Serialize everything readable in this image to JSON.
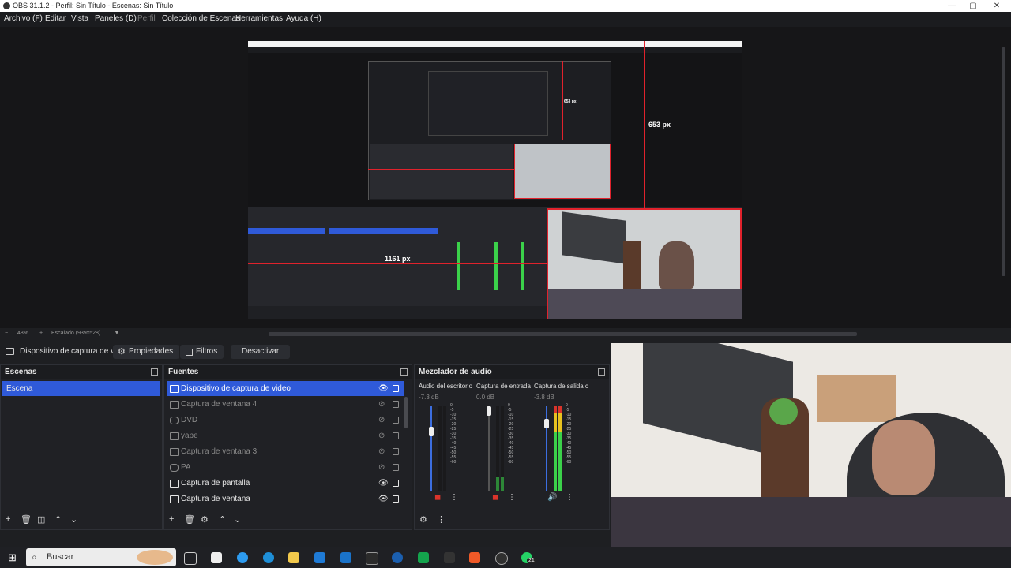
{
  "window": {
    "title": "OBS 31.1.2 - Perfil: Sin Título - Escenas: Sin Título",
    "minimize": "—",
    "maximize": "▢",
    "close": "✕"
  },
  "menu": {
    "items": [
      "Archivo (F)",
      "Editar",
      "Vista",
      "Paneles (D)",
      "Perfil",
      "Colección de Escenas",
      "Herramientas",
      "Ayuda (H)"
    ]
  },
  "preview": {
    "width_label": "1161 px",
    "height_label": "653 px",
    "inner_height_label": "653 px"
  },
  "zoom": {
    "minus": "−",
    "value": "48%",
    "plus": "+",
    "mode": "Escalado (939x528)"
  },
  "source_toolbar": {
    "source": "Dispositivo de captura de v",
    "properties": "Propiedades",
    "filters": "Filtros",
    "deactivate": "Desactivar"
  },
  "scenes": {
    "title": "Escenas",
    "items": [
      {
        "label": "Escena"
      }
    ]
  },
  "sources": {
    "title": "Fuentes",
    "items": [
      {
        "label": "Dispositivo de captura de video",
        "icon": "camera-icon",
        "visible": true
      },
      {
        "label": "Captura de ventana 4",
        "icon": "window-icon",
        "visible": false
      },
      {
        "label": "DVD",
        "icon": "link-icon",
        "visible": false
      },
      {
        "label": "yape",
        "icon": "image-icon",
        "visible": false
      },
      {
        "label": "Captura de ventana 3",
        "icon": "window-icon",
        "visible": false
      },
      {
        "label": "PA",
        "icon": "link-icon",
        "visible": false
      },
      {
        "label": "Captura de pantalla",
        "icon": "monitor-icon",
        "visible": true
      },
      {
        "label": "Captura de ventana",
        "icon": "window-icon",
        "visible": true
      }
    ]
  },
  "mixer": {
    "title": "Mezclador de audio",
    "channels": [
      {
        "name": "Audio del escritorio",
        "db": "-7.3 dB",
        "level": 0.85
      },
      {
        "name": "Captura de entrada",
        "db": "0.0 dB",
        "level": 1.0
      },
      {
        "name": "Captura de salida c",
        "db": "-3.8 dB",
        "level": 0.92
      }
    ],
    "scale": "0\n-5\n-10\n-15\n-20\n-25\n-30\n-35\n-40\n-45\n-50\n-55\n-60"
  },
  "taskbar": {
    "search_placeholder": "Buscar",
    "badge": "21"
  },
  "colors": {
    "accent": "#2f5ad9",
    "guide": "#e0222c",
    "meter_green": "#3bd14a",
    "meter_yellow": "#e8c21f",
    "meter_red": "#d9342b"
  }
}
